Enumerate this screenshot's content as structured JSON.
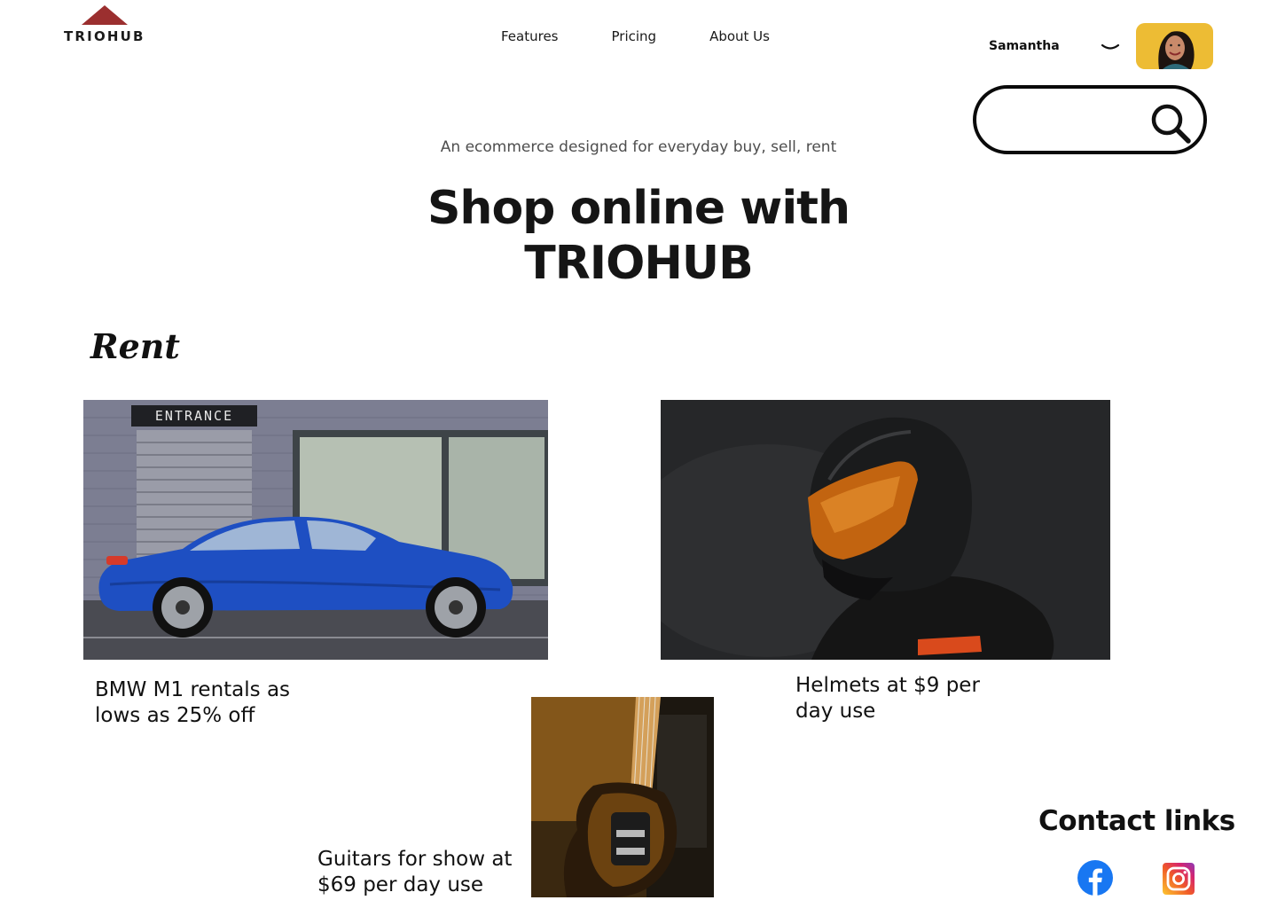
{
  "brand": {
    "name": "TRIOHUB",
    "mark_color": "#9b2f2f"
  },
  "nav": {
    "items": [
      {
        "label": "Features"
      },
      {
        "label": "Pricing"
      },
      {
        "label": "About Us"
      }
    ]
  },
  "user": {
    "name": "Samantha",
    "avatar_bg": "#f0c13a"
  },
  "search": {
    "value": "",
    "placeholder": ""
  },
  "hero": {
    "tagline": "An ecommerce designed for everyday buy, sell, rent",
    "title_line1": "Shop online with",
    "title_line2": "TRIOHUB"
  },
  "rent": {
    "title": "Rent",
    "items": [
      {
        "caption": "BMW M1 rentals as lows as 25% off",
        "image_sign": "ENTRANCE"
      },
      {
        "caption": "Helmets at $9 per day use"
      },
      {
        "caption": "Guitars for show at $69 per day use"
      }
    ]
  },
  "contact": {
    "title": "Contact links",
    "links": [
      {
        "icon": "facebook-icon"
      },
      {
        "icon": "instagram-icon"
      }
    ]
  },
  "colors": {
    "accent_red": "#9b2f2f",
    "text_dark": "#111111",
    "tagline_gray": "#4d4d4d",
    "facebook_blue": "#1877f2"
  }
}
